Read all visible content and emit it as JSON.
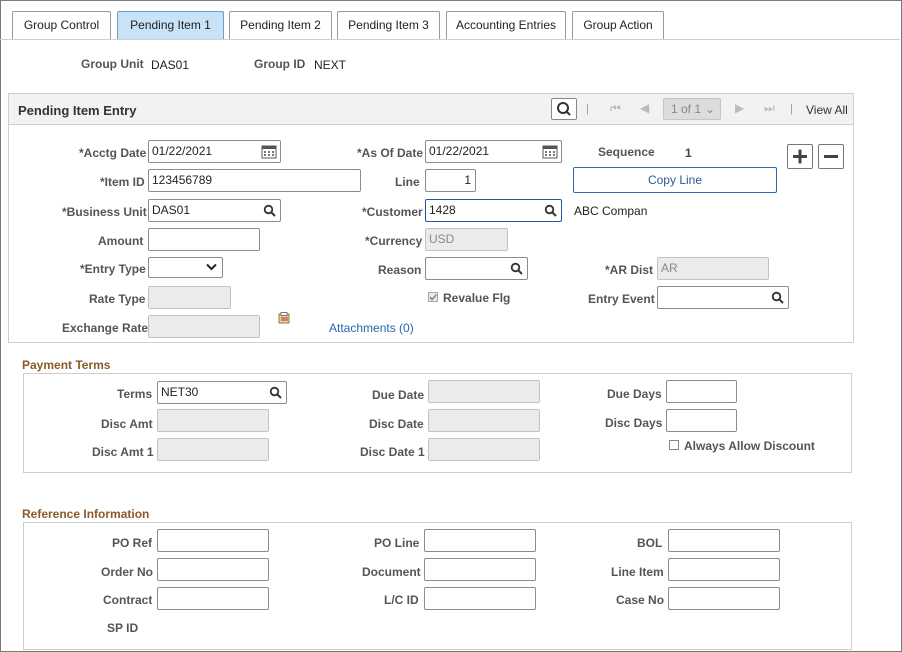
{
  "tabs": [
    {
      "label": "Group Control",
      "active": false
    },
    {
      "label": "Pending Item 1",
      "active": true
    },
    {
      "label": "Pending Item 2",
      "active": false
    },
    {
      "label": "Pending Item 3",
      "active": false
    },
    {
      "label": "Accounting Entries",
      "active": false
    },
    {
      "label": "Group Action",
      "active": false
    }
  ],
  "header": {
    "group_unit_label": "Group Unit",
    "group_unit_value": "DAS01",
    "group_id_label": "Group ID",
    "group_id_value": "NEXT"
  },
  "pending_item": {
    "title": "Pending Item Entry",
    "pager": "1 of 1",
    "view_all": "View All",
    "sep": "|",
    "acctg_date_label": "*Acctg Date",
    "acctg_date_value": "01/22/2021",
    "as_of_date_label": "*As Of Date",
    "as_of_date_value": "01/22/2021",
    "sequence_label": "Sequence",
    "sequence_value": "1",
    "item_id_label": "*Item ID",
    "item_id_value": "123456789",
    "line_label": "Line",
    "line_value": "1",
    "copy_line_label": "Copy Line",
    "business_unit_label": "*Business Unit",
    "business_unit_value": "DAS01",
    "customer_label": "*Customer",
    "customer_value": "1428",
    "customer_name": "ABC Compan",
    "amount_label": "Amount",
    "amount_value": "",
    "currency_label": "*Currency",
    "currency_value": "USD",
    "entry_type_label": "*Entry Type",
    "entry_type_value": "",
    "reason_label": "Reason",
    "reason_value": "",
    "ar_dist_label": "*AR Dist",
    "ar_dist_value": "AR",
    "rate_type_label": "Rate Type",
    "rate_type_value": "",
    "revalue_flg_label": "Revalue Flg",
    "revalue_flg_checked": true,
    "entry_event_label": "Entry Event",
    "entry_event_value": "",
    "exchange_rate_label": "Exchange Rate",
    "exchange_rate_value": "",
    "attachments_label": "Attachments (0)"
  },
  "payment_terms": {
    "title": "Payment Terms",
    "terms_label": "Terms",
    "terms_value": "NET30",
    "due_date_label": "Due Date",
    "due_days_label": "Due Days",
    "disc_amt_label": "Disc Amt",
    "disc_date_label": "Disc Date",
    "disc_days_label": "Disc Days",
    "disc_amt1_label": "Disc Amt 1",
    "disc_date1_label": "Disc Date 1",
    "always_allow_discount_label": "Always Allow Discount",
    "always_allow_discount_checked": false
  },
  "reference": {
    "title": "Reference Information",
    "po_ref_label": "PO Ref",
    "po_line_label": "PO Line",
    "bol_label": "BOL",
    "order_no_label": "Order No",
    "document_label": "Document",
    "line_item_label": "Line Item",
    "contract_label": "Contract",
    "lc_id_label": "L/C ID",
    "case_no_label": "Case No",
    "sp_id_label": "SP ID"
  },
  "colors": {
    "active_tab": "#c8e2f8",
    "section_title": "#8a5a2b",
    "link": "#2468b0",
    "focus_border": "#1e5aa8"
  },
  "icons": {
    "calendar": "calendar-icon",
    "lookup": "search-icon",
    "add": "plus-icon",
    "remove": "minus-icon",
    "attachment": "attachment-icon"
  }
}
